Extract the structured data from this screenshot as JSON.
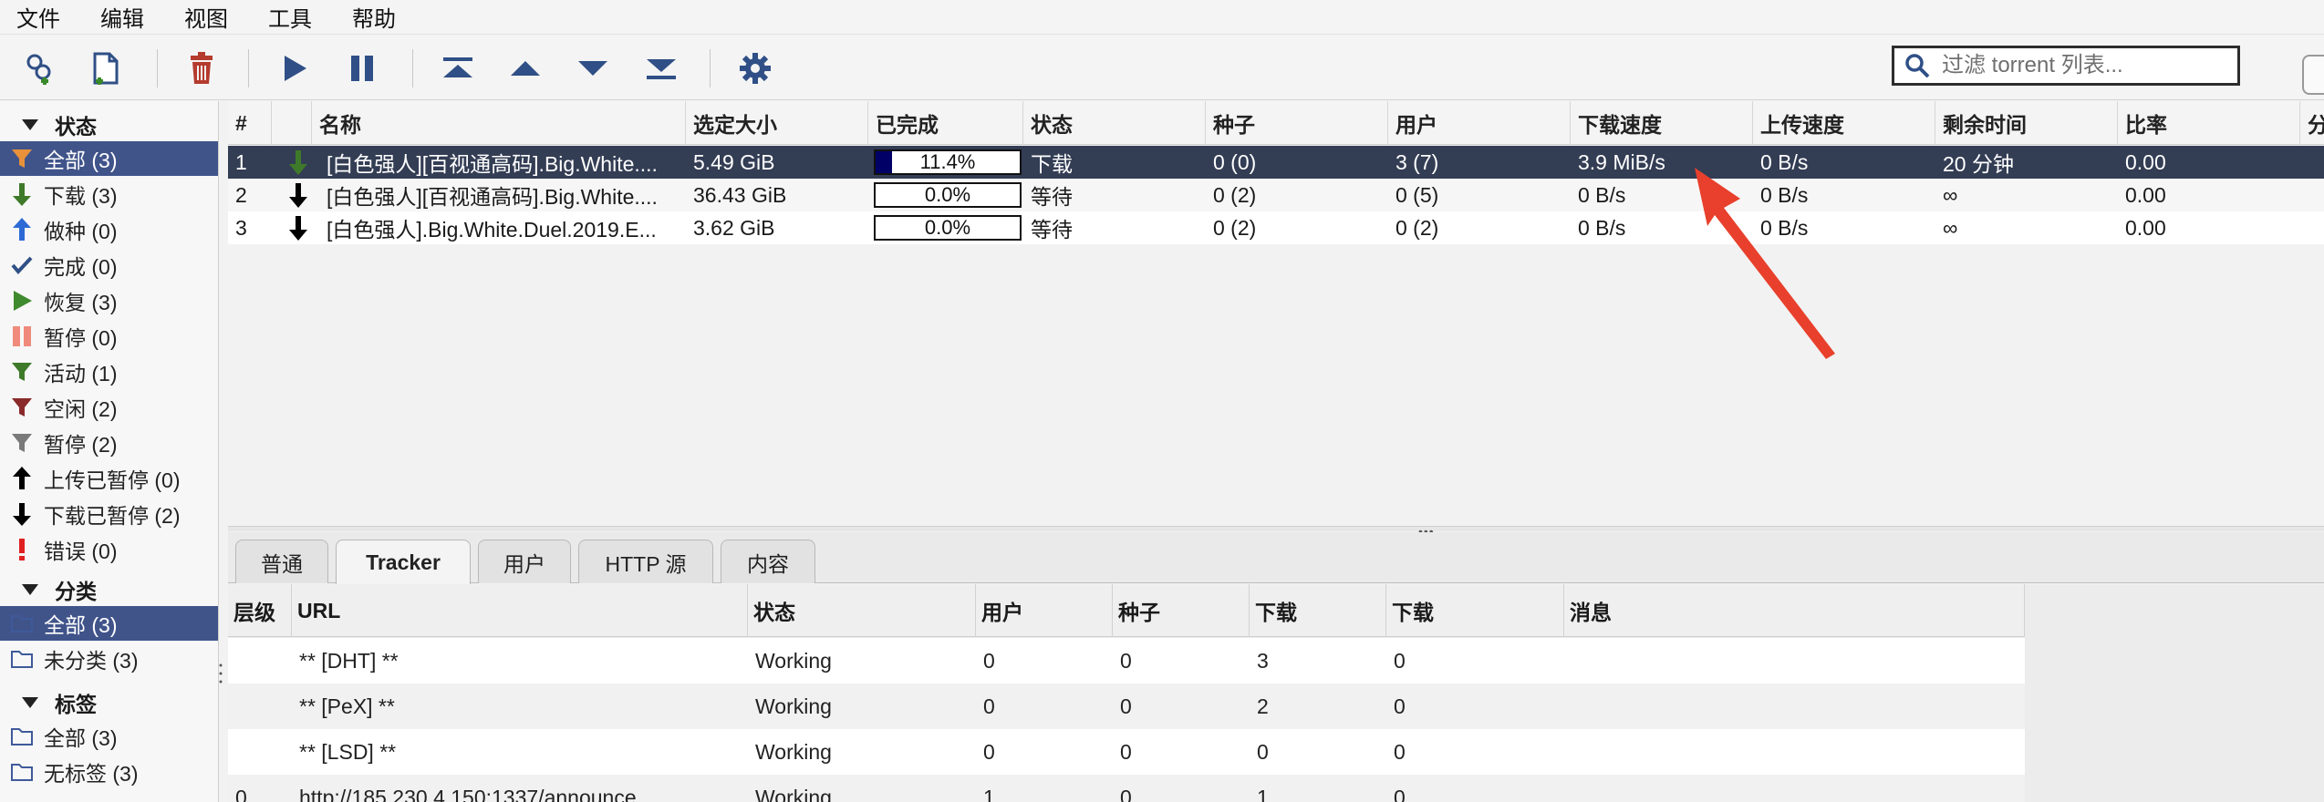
{
  "menu": [
    "文件",
    "编辑",
    "视图",
    "工具",
    "帮助"
  ],
  "toolbar": {
    "buttons": [
      {
        "icon": "add-torrent-link-icon"
      },
      {
        "icon": "add-torrent-file-icon"
      },
      {
        "icon": "delete-icon"
      },
      {
        "icon": "resume-icon"
      },
      {
        "icon": "pause-icon"
      },
      {
        "icon": "move-top-icon"
      },
      {
        "icon": "move-up-icon"
      },
      {
        "icon": "move-down-icon"
      },
      {
        "icon": "move-bottom-icon"
      },
      {
        "icon": "settings-icon"
      }
    ],
    "search_placeholder": "过滤 torrent 列表..."
  },
  "sidebar": {
    "status_header": "状态",
    "status_items": [
      {
        "label": "全部 (3)",
        "icon": "filter-all-icon",
        "selected": true
      },
      {
        "label": "下载 (3)",
        "icon": "downloading-icon"
      },
      {
        "label": "做种 (0)",
        "icon": "seeding-icon"
      },
      {
        "label": "完成 (0)",
        "icon": "completed-icon"
      },
      {
        "label": "恢复 (3)",
        "icon": "resumed-icon"
      },
      {
        "label": "暂停 (0)",
        "icon": "paused-icon"
      },
      {
        "label": "活动 (1)",
        "icon": "active-filter-icon"
      },
      {
        "label": "空闲 (2)",
        "icon": "inactive-filter-icon"
      },
      {
        "label": "暂停 (2)",
        "icon": "stalled-filter-icon"
      },
      {
        "label": "上传已暂停 (0)",
        "icon": "stalled-upload-icon"
      },
      {
        "label": "下载已暂停 (2)",
        "icon": "stalled-download-icon"
      },
      {
        "label": "错误 (0)",
        "icon": "error-icon"
      }
    ],
    "category_header": "分类",
    "category_items": [
      {
        "label": "全部 (3)",
        "icon": "folder-icon",
        "selected": true
      },
      {
        "label": "未分类 (3)",
        "icon": "folder-icon"
      }
    ],
    "tag_header": "标签",
    "tag_items": [
      {
        "label": "全部 (3)",
        "icon": "folder-icon"
      },
      {
        "label": "无标签 (3)",
        "icon": "folder-icon"
      }
    ]
  },
  "torrent_table": {
    "columns": [
      "#",
      "",
      "名称",
      "选定大小",
      "已完成",
      "状态",
      "种子",
      "用户",
      "下载速度",
      "上传速度",
      "剩余时间",
      "比率",
      "分"
    ],
    "rows": [
      {
        "num": "1",
        "name": "[白色强人][百视通高码].Big.White....",
        "size": "5.49 GiB",
        "progress_text": "11.4%",
        "progress": 0.114,
        "status": "下载",
        "seeds": "0 (0)",
        "peers": "3 (7)",
        "down": "3.9 MiB/s",
        "up": "0 B/s",
        "eta": "20 分钟",
        "ratio": "0.00"
      },
      {
        "num": "2",
        "name": "[白色强人][百视通高码].Big.White....",
        "size": "36.43 GiB",
        "progress_text": "0.0%",
        "progress": 0.0,
        "status": "等待",
        "seeds": "0 (2)",
        "peers": "0 (5)",
        "down": "0 B/s",
        "up": "0 B/s",
        "eta": "∞",
        "ratio": "0.00"
      },
      {
        "num": "3",
        "name": "[白色强人].Big.White.Duel.2019.E...",
        "size": "3.62 GiB",
        "progress_text": "0.0%",
        "progress": 0.0,
        "status": "等待",
        "seeds": "0 (2)",
        "peers": "0 (2)",
        "down": "0 B/s",
        "up": "0 B/s",
        "eta": "∞",
        "ratio": "0.00"
      }
    ]
  },
  "tabs": [
    "普通",
    "Tracker",
    "用户",
    "HTTP 源",
    "内容"
  ],
  "active_tab": "Tracker",
  "tracker_table": {
    "columns": [
      "层级",
      "URL",
      "状态",
      "用户",
      "种子",
      "下载",
      "下载",
      "消息"
    ],
    "rows": [
      {
        "tier": "",
        "url": "** [DHT] **",
        "status": "Working",
        "peers": "0",
        "seeds": "0",
        "leeches": "3",
        "downloaded": "0",
        "message": ""
      },
      {
        "tier": "",
        "url": "** [PeX] **",
        "status": "Working",
        "peers": "0",
        "seeds": "0",
        "leeches": "2",
        "downloaded": "0",
        "message": ""
      },
      {
        "tier": "",
        "url": "** [LSD] **",
        "status": "Working",
        "peers": "0",
        "seeds": "0",
        "leeches": "0",
        "downloaded": "0",
        "message": ""
      },
      {
        "tier": "0",
        "url": "http://185.230.4.150:1337/announce",
        "status": "Working",
        "peers": "1",
        "seeds": "0",
        "leeches": "1",
        "downloaded": "0",
        "message": ""
      }
    ]
  },
  "colors": {
    "selection": "#40548a",
    "row_selected": "#333d54",
    "progress_fill": "#000066",
    "annotation_arrow": "#e8402c"
  }
}
